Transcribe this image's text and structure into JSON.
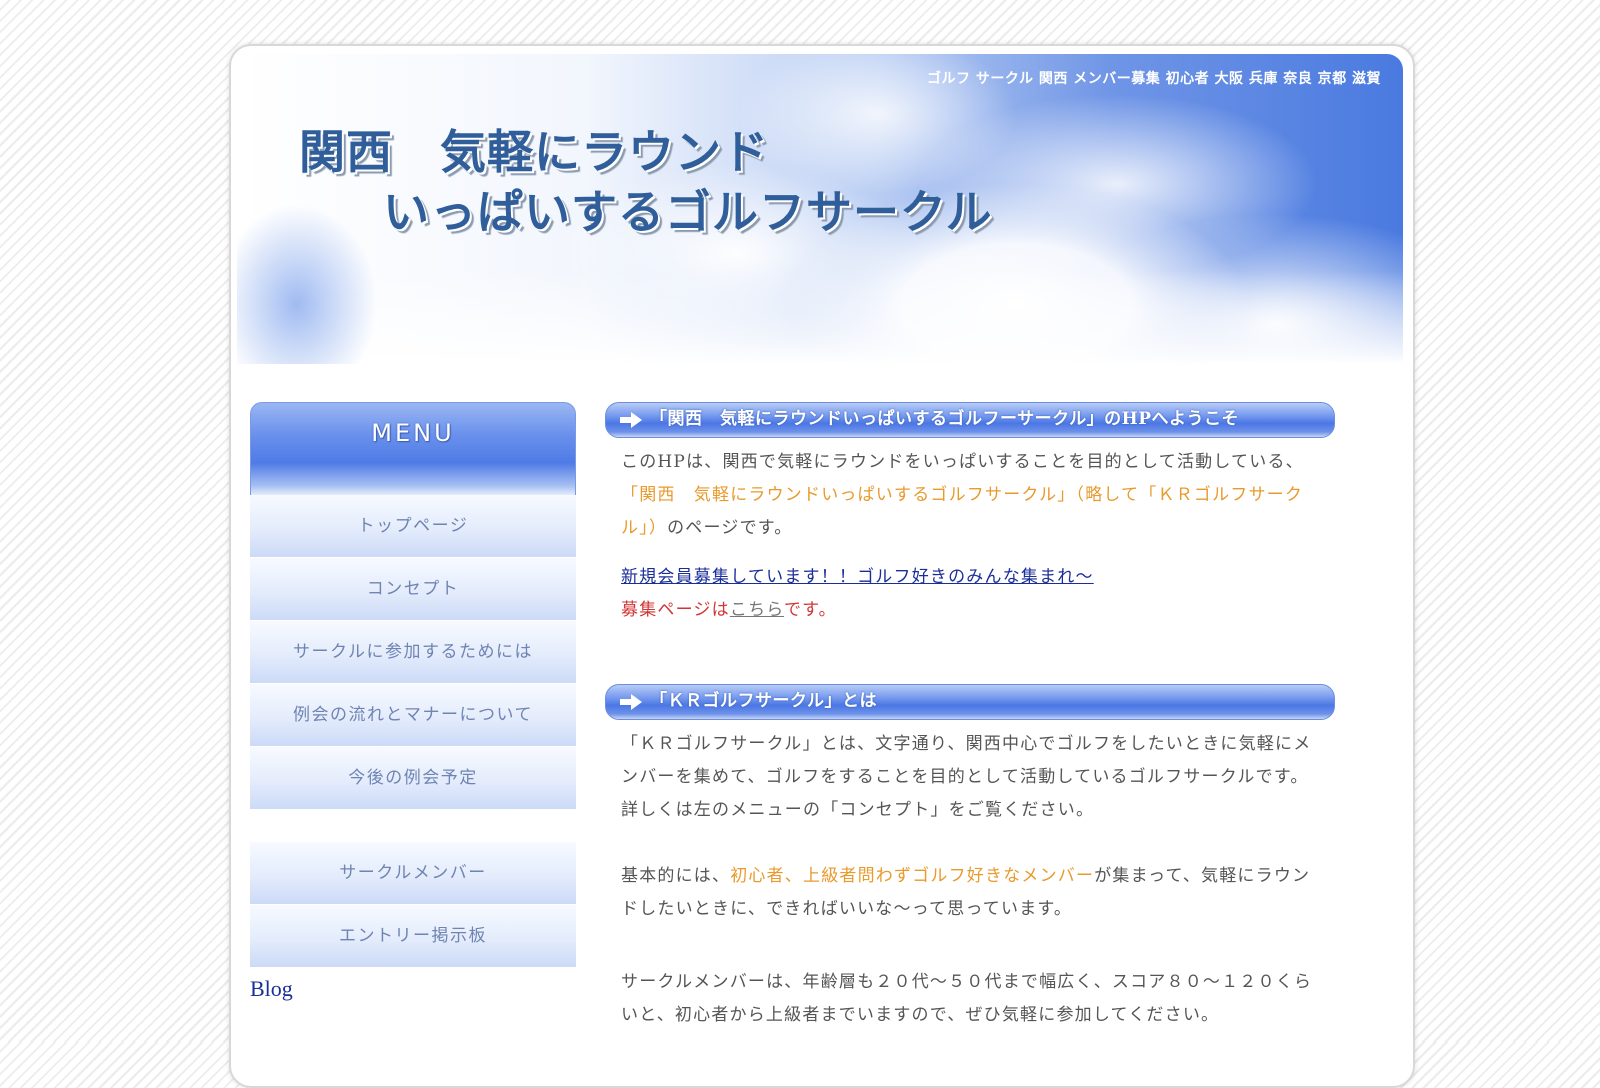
{
  "header": {
    "keywords": "ゴルフ サークル 関西 メンバー募集 初心者 大阪 兵庫 奈良 京都 滋賀",
    "title_line1": "関西　気軽にラウンド",
    "title_line2": "いっぱいするゴルフサークル"
  },
  "menu": {
    "heading": "MENU",
    "items": [
      "トップページ",
      "コンセプト",
      "サークルに参加するためには",
      "例会の流れとマナーについて",
      "今後の例会予定"
    ],
    "items2": [
      "サークルメンバー",
      "エントリー掲示板"
    ],
    "blog": "Blog"
  },
  "sections": {
    "welcome": {
      "title": "「関西　気軽にラウンドいっぱいするゴルフーサークル」のHPへようこそ",
      "intro_a": "このHPは、関西で気軽にラウンドをいっぱいすることを目的として活動している、",
      "intro_hl": "「関西　気軽にラウンドいっぱいするゴルフサークル」（略して「ＫＲゴルフサークル」）",
      "intro_b": "のページです。",
      "recruit_link": "新規会員募集しています！！ゴルフ好きのみんな集まれ〜",
      "recruit_prefix": "募集ページは",
      "recruit_here": "こちら",
      "recruit_suffix": "です。"
    },
    "about": {
      "title": "「ＫＲゴルフサークル」とは",
      "p1": "「ＫＲゴルフサークル」とは、文字通り、関西中心でゴルフをしたいときに気軽にメンバーを集めて、ゴルフをすることを目的として活動しているゴルフサークルです。詳しくは左のメニューの「コンセプト」をご覧ください。",
      "p2_a": "基本的には、",
      "p2_hl": "初心者、上級者問わずゴルフ好きなメンバー",
      "p2_b": "が集まって、気軽にラウンドしたいときに、できればいいな〜って思っています。",
      "p3": "サークルメンバーは、年齢層も２０代〜５０代まで幅広く、スコア８０〜１２０くらいと、初心者から上級者までいますので、ぜひ気軽に参加してください。"
    }
  },
  "colors": {
    "accent_blue": "#4b77e5",
    "highlight_orange": "#e89a2c",
    "notice_red": "#d23535",
    "link_blue": "#1a2e99"
  }
}
